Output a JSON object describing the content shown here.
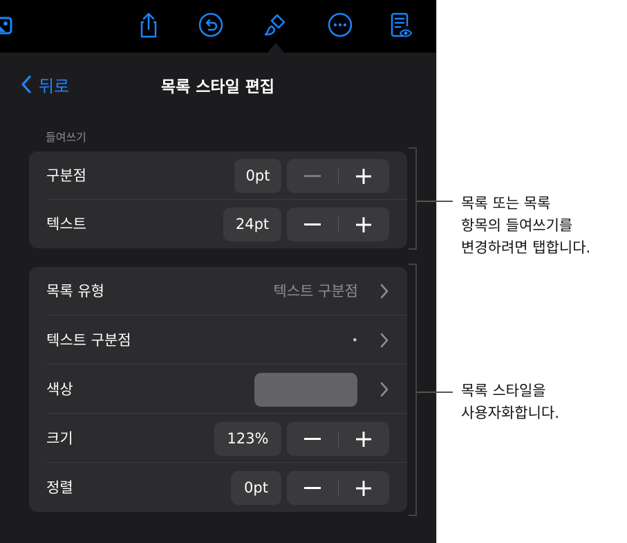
{
  "toolbar": {
    "icons": [
      "photo-icon",
      "share-icon",
      "undo-icon",
      "format-brush-icon",
      "more-icon",
      "reading-view-icon"
    ],
    "accent_color": "#1a84ff"
  },
  "popover": {
    "back_label": "뒤로",
    "title": "목록 스타일 편집",
    "indent_section_label": "들여쓰기",
    "indent_rows": [
      {
        "label": "구분점",
        "value": "0pt"
      },
      {
        "label": "텍스트",
        "value": "24pt"
      }
    ],
    "style_rows": {
      "list_type": {
        "label": "목록 유형",
        "value": "텍스트 구분점"
      },
      "text_bullet": {
        "label": "텍스트 구분점",
        "value": "•"
      },
      "color": {
        "label": "색상",
        "swatch": "#636366"
      },
      "size": {
        "label": "크기",
        "value": "123%"
      },
      "align": {
        "label": "정렬",
        "value": "0pt"
      }
    }
  },
  "callouts": {
    "indent": [
      "목록 또는 목록",
      "항목의 들여쓰기를",
      "변경하려면 탭합니다."
    ],
    "style": [
      "목록 스타일을",
      "사용자화합니다."
    ]
  }
}
